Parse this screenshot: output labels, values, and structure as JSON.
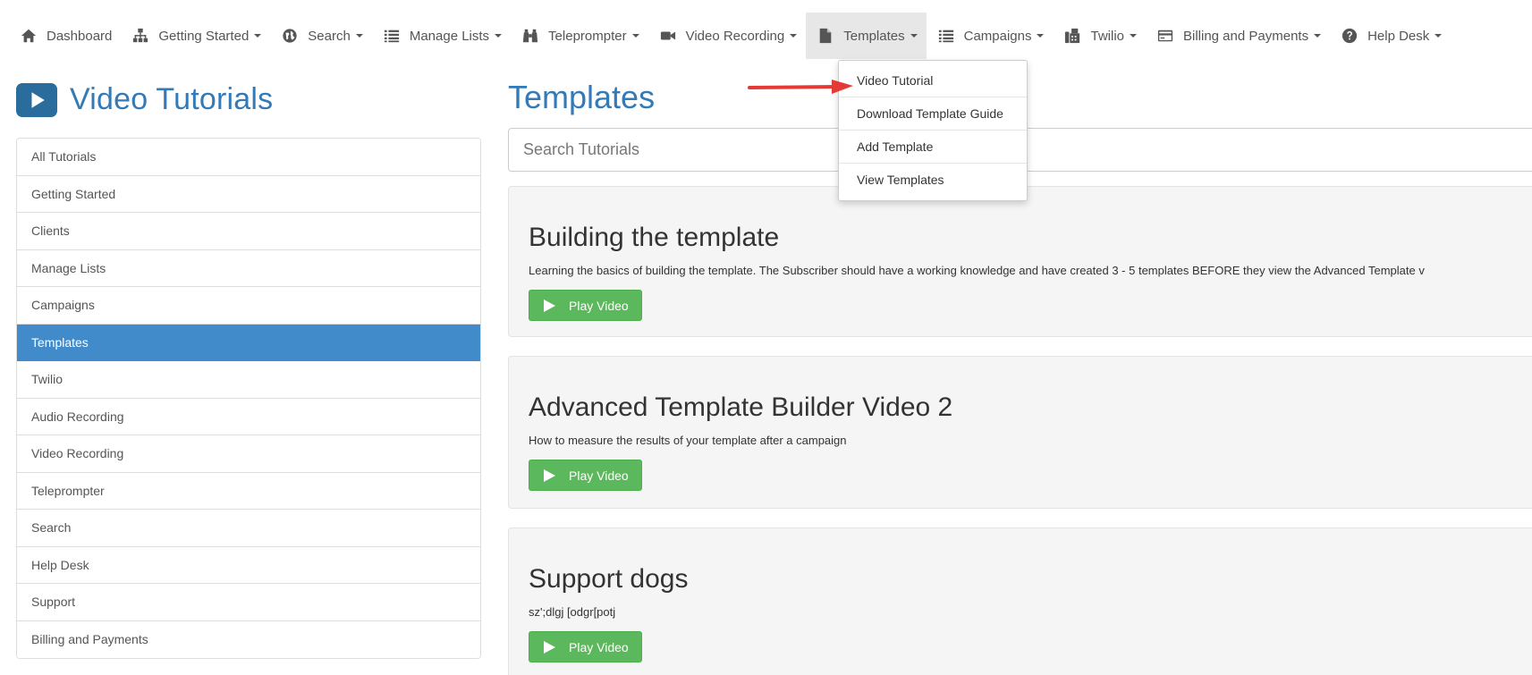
{
  "nav": {
    "items": [
      {
        "label": "Dashboard",
        "icon": "home-icon",
        "caret": false
      },
      {
        "label": "Getting Started",
        "icon": "sitemap-icon",
        "caret": true
      },
      {
        "label": "Search",
        "icon": "globe-icon",
        "caret": true
      },
      {
        "label": "Manage Lists",
        "icon": "list-icon",
        "caret": true
      },
      {
        "label": "Teleprompter",
        "icon": "binoculars-icon",
        "caret": true
      },
      {
        "label": "Video Recording",
        "icon": "video-camera-icon",
        "caret": true
      },
      {
        "label": "Templates",
        "icon": "file-icon",
        "caret": true
      },
      {
        "label": "Campaigns",
        "icon": "list-icon",
        "caret": true
      },
      {
        "label": "Twilio",
        "icon": "fax-icon",
        "caret": true
      },
      {
        "label": "Billing and Payments",
        "icon": "credit-card-icon",
        "caret": true
      },
      {
        "label": "Help Desk",
        "icon": "question-circle-icon",
        "caret": true
      }
    ]
  },
  "dropdown": {
    "items": [
      "Video Tutorial",
      "Download Template Guide",
      "Add Template",
      "View Templates"
    ]
  },
  "sidebar": {
    "title": "Video Tutorials",
    "items": [
      "All Tutorials",
      "Getting Started",
      "Clients",
      "Manage Lists",
      "Campaigns",
      "Templates",
      "Twilio",
      "Audio Recording",
      "Video Recording",
      "Teleprompter",
      "Search",
      "Help Desk",
      "Support",
      "Billing and Payments"
    ],
    "active_index": 5
  },
  "main": {
    "title": "Templates",
    "search_placeholder": "Search Tutorials",
    "cards": [
      {
        "title": "Building the template",
        "desc": "Learning the basics of building the template. The Subscriber should have a working knowledge and have created 3 - 5 templates BEFORE they view the Advanced Template v",
        "button": "Play Video"
      },
      {
        "title": "Advanced Template Builder Video 2",
        "desc": "How to measure the results of your template after a campaign",
        "button": "Play Video"
      },
      {
        "title": "Support dogs",
        "desc": "sz';dlgj [odgr[potj",
        "button": "Play Video"
      }
    ]
  },
  "colors": {
    "accent": "#337ab7",
    "active": "#428bca",
    "play": "#5cb85c",
    "arrow": "#e53935"
  }
}
